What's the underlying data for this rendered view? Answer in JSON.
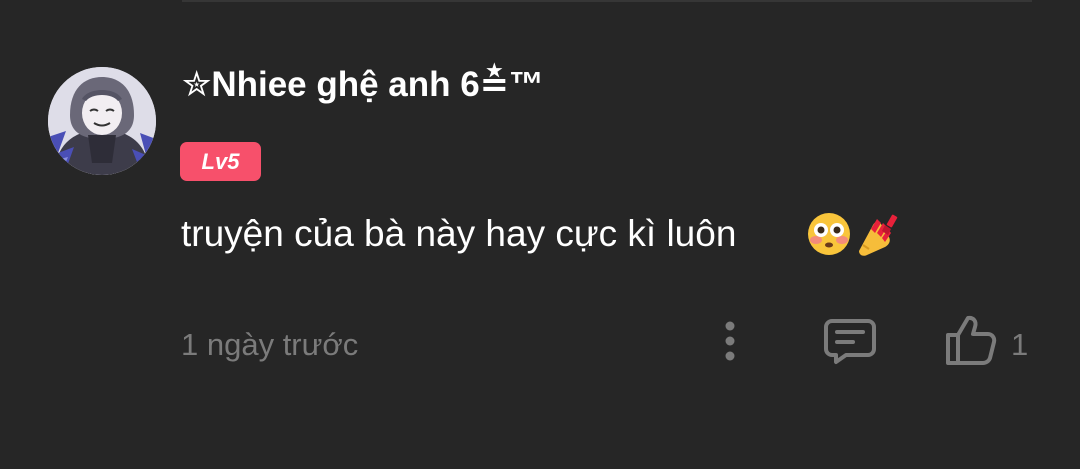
{
  "comment": {
    "username": "✮Nhiee ghệ anh 6≛™",
    "level_badge": "Lv5",
    "text": "truyện của bà này hay cực kì luôn",
    "emojis": [
      "flushed-face-emoji",
      "nail-polish-emoji"
    ],
    "timestamp": "1 ngày trước",
    "like_count": "1",
    "icons": {
      "more": "more-vertical-icon",
      "reply": "comment-icon",
      "like": "thumbs-up-icon"
    },
    "colors": {
      "background": "#262626",
      "username": "#ffffff",
      "badge": "#f7506b",
      "muted": "#7b7b7b"
    }
  }
}
